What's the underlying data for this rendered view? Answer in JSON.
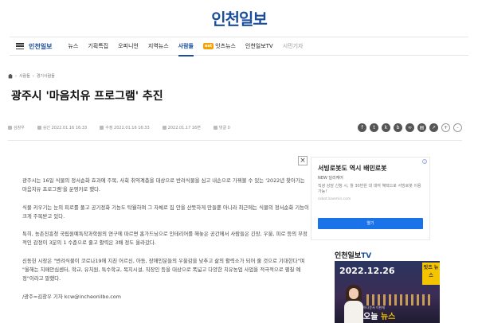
{
  "site": {
    "logo": "인천일보",
    "brand": "인천일보"
  },
  "nav": {
    "items": [
      {
        "label": "뉴스",
        "state": "normal"
      },
      {
        "label": "기획특집",
        "state": "normal"
      },
      {
        "label": "오피니언",
        "state": "normal"
      },
      {
        "label": "지역뉴스",
        "state": "normal"
      },
      {
        "label": "사람들",
        "state": "active"
      },
      {
        "label": "잇츠뉴스",
        "state": "normal",
        "badge": "eat"
      },
      {
        "label": "인천일보TV",
        "state": "normal"
      },
      {
        "label": "시민기자",
        "state": "muted"
      }
    ]
  },
  "breadcrumb": {
    "home_icon": "home-icon",
    "level1": "사람들",
    "level2": "경기사람들"
  },
  "article": {
    "title": "광주시 '마음치유 프로그램' 추진",
    "author": "김창우",
    "approved": "승인 2022.01.16 16:33",
    "modified": "수정 2022.01.16 16:33",
    "published": "2022.01.17 16면",
    "comments": "댓글 0",
    "share_icons": [
      "facebook-icon",
      "twitter-icon",
      "kakaostory-icon",
      "blog-icon"
    ],
    "tool_icons": [
      "link-icon",
      "print-icon",
      "share-icon"
    ],
    "font_up": "+",
    "font_down": "-",
    "paragraphs": [
      "광주시는 16일 식물의 정서순화 효과에 주목, 사회 취약계층을 대상으로 반려식물을 심고 내손으로 가꿔볼 수 있는 '2022년 찾아가는 마음치유 프로그램'을 운영키로 했다.",
      "식물 키우기는 눈의 피로를 풀고 공기정화 기능도 탁월하며 그 자체로 집 안을 산뜻하게 만들뿐 아니라 최근에는 식물의 정서순화 기능이 크게 주목받고 있다.",
      "특히, 농촌진흥청 국립원예특작과학원의 연구에 따르면 홈가드닝으로 인테리어를 해놓은 공간에서 사람들은 긴장, 우울, 피로 등의 부정적인 감정이 3분의 1 수준으로 줄고 활력은 3배 정도 올라갔다.",
      "신동헌 시장은 \"반려식물이 코로나19에 지친 어르신, 아동, 장애인분들의 우울감을 낮추고 삶의 활력소가 되어 줄 것으로 기대한다\"며 \"올해는 치매안심센터, 학교, 유치원, 특수학교, 복지시설, 직장인 등을 대상으로 폭넓고 다양한 치유농업 사업을 적극적으로 펼칠 예정\"이라고 말했다.",
      "/광주=김창우 기자 kcw@incheonilbo.com"
    ]
  },
  "ad": {
    "close": "×",
    "info": "i",
    "headline": "서빙로봇도 역시 배민로봇",
    "advertiser": "NEW 딜리케어",
    "description": "직광 상담 신청 시, 월 30만원 대 대여 혜택으로 서빙로봇 이용 가능!",
    "url": "robot.baemin.com",
    "button": "열기"
  },
  "tv": {
    "label_prefix": "인천일보",
    "label_suffix": "TV",
    "video_date": "2022.12.26",
    "video_logo": "잇츠 뉴스",
    "video_small": "아나운서 이현재",
    "video_caption_a": "오늘 ",
    "video_caption_b": "뉴스"
  },
  "colors": {
    "brand": "#1a4e9c",
    "ad_button": "#1a73e8",
    "eat_badge": "#f5a100"
  }
}
